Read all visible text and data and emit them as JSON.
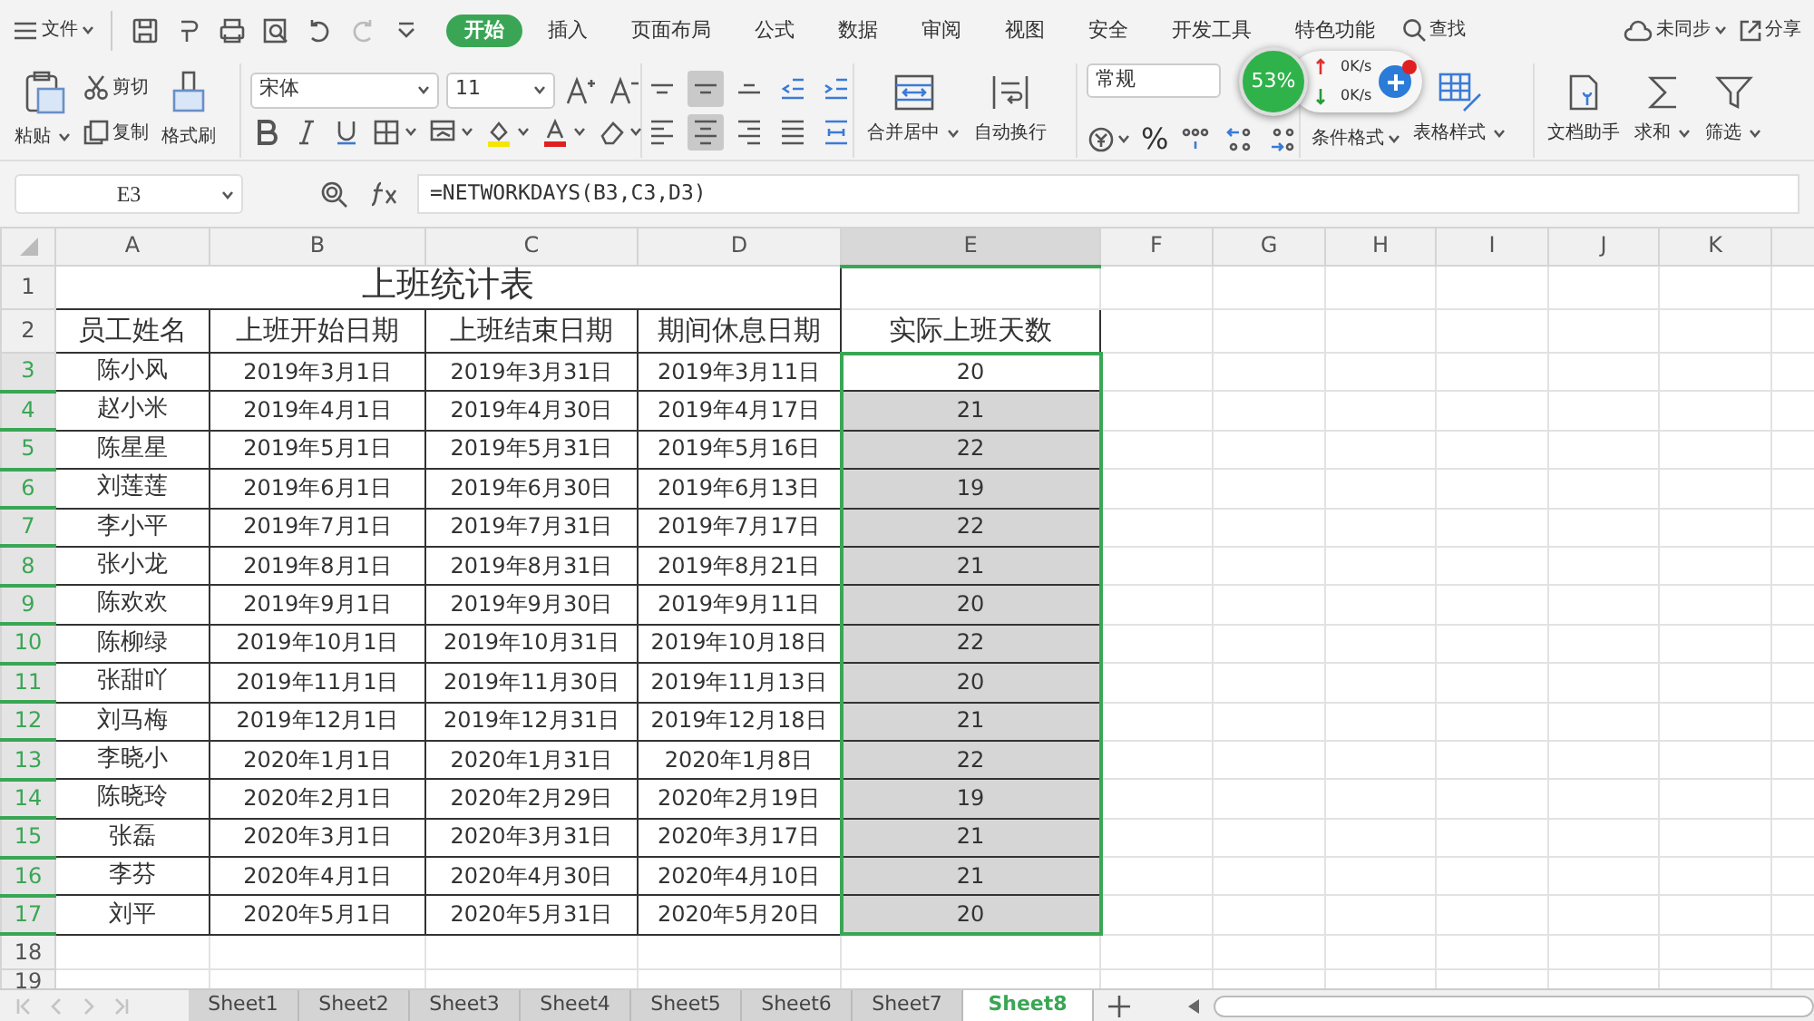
{
  "menu": {
    "file": "文件",
    "tabs": [
      {
        "label": "开始",
        "selected": true
      },
      {
        "label": "插入",
        "selected": false
      },
      {
        "label": "页面布局",
        "selected": false
      },
      {
        "label": "公式",
        "selected": false
      },
      {
        "label": "数据",
        "selected": false
      },
      {
        "label": "审阅",
        "selected": false
      },
      {
        "label": "视图",
        "selected": false
      },
      {
        "label": "安全",
        "selected": false
      },
      {
        "label": "开发工具",
        "selected": false
      },
      {
        "label": "特色功能",
        "selected": false
      }
    ],
    "search": "查找",
    "sync": "未同步",
    "share": "分享"
  },
  "ribbon": {
    "paste": "粘贴",
    "cut": "剪切",
    "copy": "复制",
    "format_painter": "格式刷",
    "font": "宋体",
    "font_size": "11",
    "alignment_buttons": [
      {
        "kind": "top",
        "selected": false
      },
      {
        "kind": "middle",
        "selected": true
      },
      {
        "kind": "bottom",
        "selected": false
      },
      {
        "kind": "outdent",
        "selected": false
      },
      {
        "kind": "indent",
        "selected": false
      },
      {
        "kind": "left",
        "selected": false
      },
      {
        "kind": "center",
        "selected": true
      },
      {
        "kind": "right",
        "selected": false
      },
      {
        "kind": "justify",
        "selected": false
      },
      {
        "kind": "distributed",
        "selected": false
      }
    ],
    "merge": "合并居中",
    "wrap": "自动换行",
    "number_format": "常规",
    "percent": "%",
    "conditional_format": "条件格式",
    "table_style": "表格样式",
    "doc_assistant": "文档助手",
    "sum": "求和",
    "filter": "筛选"
  },
  "net_widget": {
    "percent": "53%",
    "upload": "0K/s",
    "download": "0K/s"
  },
  "formula_bar": {
    "name_box": "E3",
    "formula": "=NETWORKDAYS(B3,C3,D3)"
  },
  "sheet": {
    "columns": [
      {
        "label": "A",
        "selected": false
      },
      {
        "label": "B",
        "selected": false
      },
      {
        "label": "C",
        "selected": false
      },
      {
        "label": "D",
        "selected": false
      },
      {
        "label": "E",
        "selected": true
      },
      {
        "label": "F",
        "selected": false
      },
      {
        "label": "G",
        "selected": false
      },
      {
        "label": "H",
        "selected": false
      },
      {
        "label": "I",
        "selected": false
      },
      {
        "label": "J",
        "selected": false
      },
      {
        "label": "K",
        "selected": false
      }
    ],
    "rows": [
      {
        "number": "1",
        "kind": "title",
        "selected": false,
        "cells": [
          "上班统计表"
        ]
      },
      {
        "number": "2",
        "kind": "header",
        "selected": false,
        "cells": [
          "员工姓名",
          "上班开始日期",
          "上班结束日期",
          "期间休息日期",
          "实际上班天数"
        ]
      },
      {
        "number": "3",
        "kind": "data",
        "selected": true,
        "active": true,
        "cells": [
          "陈小风",
          "2019年3月1日",
          "2019年3月31日",
          "2019年3月11日",
          "20"
        ]
      },
      {
        "number": "4",
        "kind": "data",
        "selected": true,
        "active": false,
        "cells": [
          "赵小米",
          "2019年4月1日",
          "2019年4月30日",
          "2019年4月17日",
          "21"
        ]
      },
      {
        "number": "5",
        "kind": "data",
        "selected": true,
        "active": false,
        "cells": [
          "陈星星",
          "2019年5月1日",
          "2019年5月31日",
          "2019年5月16日",
          "22"
        ]
      },
      {
        "number": "6",
        "kind": "data",
        "selected": true,
        "active": false,
        "cells": [
          "刘莲莲",
          "2019年6月1日",
          "2019年6月30日",
          "2019年6月13日",
          "19"
        ]
      },
      {
        "number": "7",
        "kind": "data",
        "selected": true,
        "active": false,
        "cells": [
          "李小平",
          "2019年7月1日",
          "2019年7月31日",
          "2019年7月17日",
          "22"
        ]
      },
      {
        "number": "8",
        "kind": "data",
        "selected": true,
        "active": false,
        "cells": [
          "张小龙",
          "2019年8月1日",
          "2019年8月31日",
          "2019年8月21日",
          "21"
        ]
      },
      {
        "number": "9",
        "kind": "data",
        "selected": true,
        "active": false,
        "cells": [
          "陈欢欢",
          "2019年9月1日",
          "2019年9月30日",
          "2019年9月11日",
          "20"
        ]
      },
      {
        "number": "10",
        "kind": "data",
        "selected": true,
        "active": false,
        "cells": [
          "陈柳绿",
          "2019年10月1日",
          "2019年10月31日",
          "2019年10月18日",
          "22"
        ]
      },
      {
        "number": "11",
        "kind": "data",
        "selected": true,
        "active": false,
        "cells": [
          "张甜吖",
          "2019年11月1日",
          "2019年11月30日",
          "2019年11月13日",
          "20"
        ]
      },
      {
        "number": "12",
        "kind": "data",
        "selected": true,
        "active": false,
        "cells": [
          "刘马梅",
          "2019年12月1日",
          "2019年12月31日",
          "2019年12月18日",
          "21"
        ]
      },
      {
        "number": "13",
        "kind": "data",
        "selected": true,
        "active": false,
        "cells": [
          "李晓小",
          "2020年1月1日",
          "2020年1月31日",
          "2020年1月8日",
          "22"
        ]
      },
      {
        "number": "14",
        "kind": "data",
        "selected": true,
        "active": false,
        "cells": [
          "陈晓玲",
          "2020年2月1日",
          "2020年2月29日",
          "2020年2月19日",
          "19"
        ]
      },
      {
        "number": "15",
        "kind": "data",
        "selected": true,
        "active": false,
        "cells": [
          "张磊",
          "2020年3月1日",
          "2020年3月31日",
          "2020年3月17日",
          "21"
        ]
      },
      {
        "number": "16",
        "kind": "data",
        "selected": true,
        "active": false,
        "cells": [
          "李芬",
          "2020年4月1日",
          "2020年4月30日",
          "2020年4月10日",
          "21"
        ]
      },
      {
        "number": "17",
        "kind": "data",
        "selected": true,
        "active": false,
        "cells": [
          "刘平",
          "2020年5月1日",
          "2020年5月31日",
          "2020年5月20日",
          "20"
        ]
      },
      {
        "number": "18",
        "kind": "empty",
        "selected": false
      },
      {
        "number": "19",
        "kind": "empty",
        "selected": false
      }
    ]
  },
  "sheet_tabs": [
    {
      "label": "Sheet1",
      "selected": false
    },
    {
      "label": "Sheet2",
      "selected": false
    },
    {
      "label": "Sheet3",
      "selected": false
    },
    {
      "label": "Sheet4",
      "selected": false
    },
    {
      "label": "Sheet5",
      "selected": false
    },
    {
      "label": "Sheet6",
      "selected": false
    },
    {
      "label": "Sheet7",
      "selected": false
    },
    {
      "label": "Sheet8",
      "selected": true
    }
  ]
}
